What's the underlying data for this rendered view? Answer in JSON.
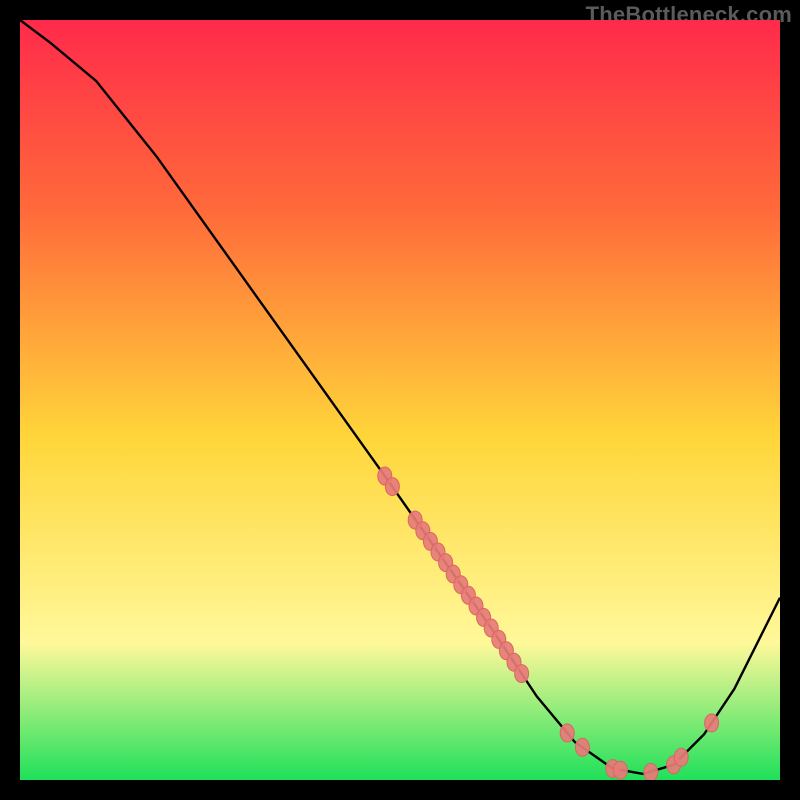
{
  "watermark": "TheBottleneck.com",
  "colors": {
    "background": "#000000",
    "gradient_top": "#ff2a4b",
    "gradient_mid1": "#ff6a3a",
    "gradient_mid2": "#ffd63a",
    "gradient_mid3": "#fff89a",
    "gradient_bottom": "#1fe05a",
    "curve": "#000000",
    "markers_fill": "#e77b78",
    "markers_stroke": "#d86763",
    "watermark": "#5b5b5b"
  },
  "chart_data": {
    "type": "line",
    "title": "",
    "xlabel": "",
    "ylabel": "",
    "xlim": [
      0,
      100
    ],
    "ylim": [
      0,
      100
    ],
    "curve": [
      {
        "x": 0,
        "y": 100
      },
      {
        "x": 4,
        "y": 97
      },
      {
        "x": 10,
        "y": 92
      },
      {
        "x": 18,
        "y": 82
      },
      {
        "x": 28,
        "y": 68
      },
      {
        "x": 38,
        "y": 54
      },
      {
        "x": 48,
        "y": 40
      },
      {
        "x": 55,
        "y": 30
      },
      {
        "x": 62,
        "y": 20
      },
      {
        "x": 68,
        "y": 11
      },
      {
        "x": 73,
        "y": 5
      },
      {
        "x": 78,
        "y": 1.5
      },
      {
        "x": 82,
        "y": 0.8
      },
      {
        "x": 86,
        "y": 2
      },
      {
        "x": 90,
        "y": 6
      },
      {
        "x": 94,
        "y": 12
      },
      {
        "x": 98,
        "y": 20
      },
      {
        "x": 100,
        "y": 24
      }
    ],
    "markers": [
      {
        "x": 48,
        "y": 40
      },
      {
        "x": 49,
        "y": 38.6
      },
      {
        "x": 52,
        "y": 34.2
      },
      {
        "x": 53,
        "y": 32.8
      },
      {
        "x": 54,
        "y": 31.4
      },
      {
        "x": 55,
        "y": 30
      },
      {
        "x": 56,
        "y": 28.6
      },
      {
        "x": 57,
        "y": 27.1
      },
      {
        "x": 58,
        "y": 25.7
      },
      {
        "x": 59,
        "y": 24.3
      },
      {
        "x": 60,
        "y": 22.9
      },
      {
        "x": 61,
        "y": 21.4
      },
      {
        "x": 62,
        "y": 20
      },
      {
        "x": 63,
        "y": 18.5
      },
      {
        "x": 64,
        "y": 17
      },
      {
        "x": 65,
        "y": 15.5
      },
      {
        "x": 66,
        "y": 14
      },
      {
        "x": 72,
        "y": 6.2
      },
      {
        "x": 74,
        "y": 4.3
      },
      {
        "x": 78,
        "y": 1.5
      },
      {
        "x": 79,
        "y": 1.3
      },
      {
        "x": 83,
        "y": 1
      },
      {
        "x": 86,
        "y": 2
      },
      {
        "x": 87,
        "y": 3
      },
      {
        "x": 91,
        "y": 7.5
      }
    ]
  }
}
